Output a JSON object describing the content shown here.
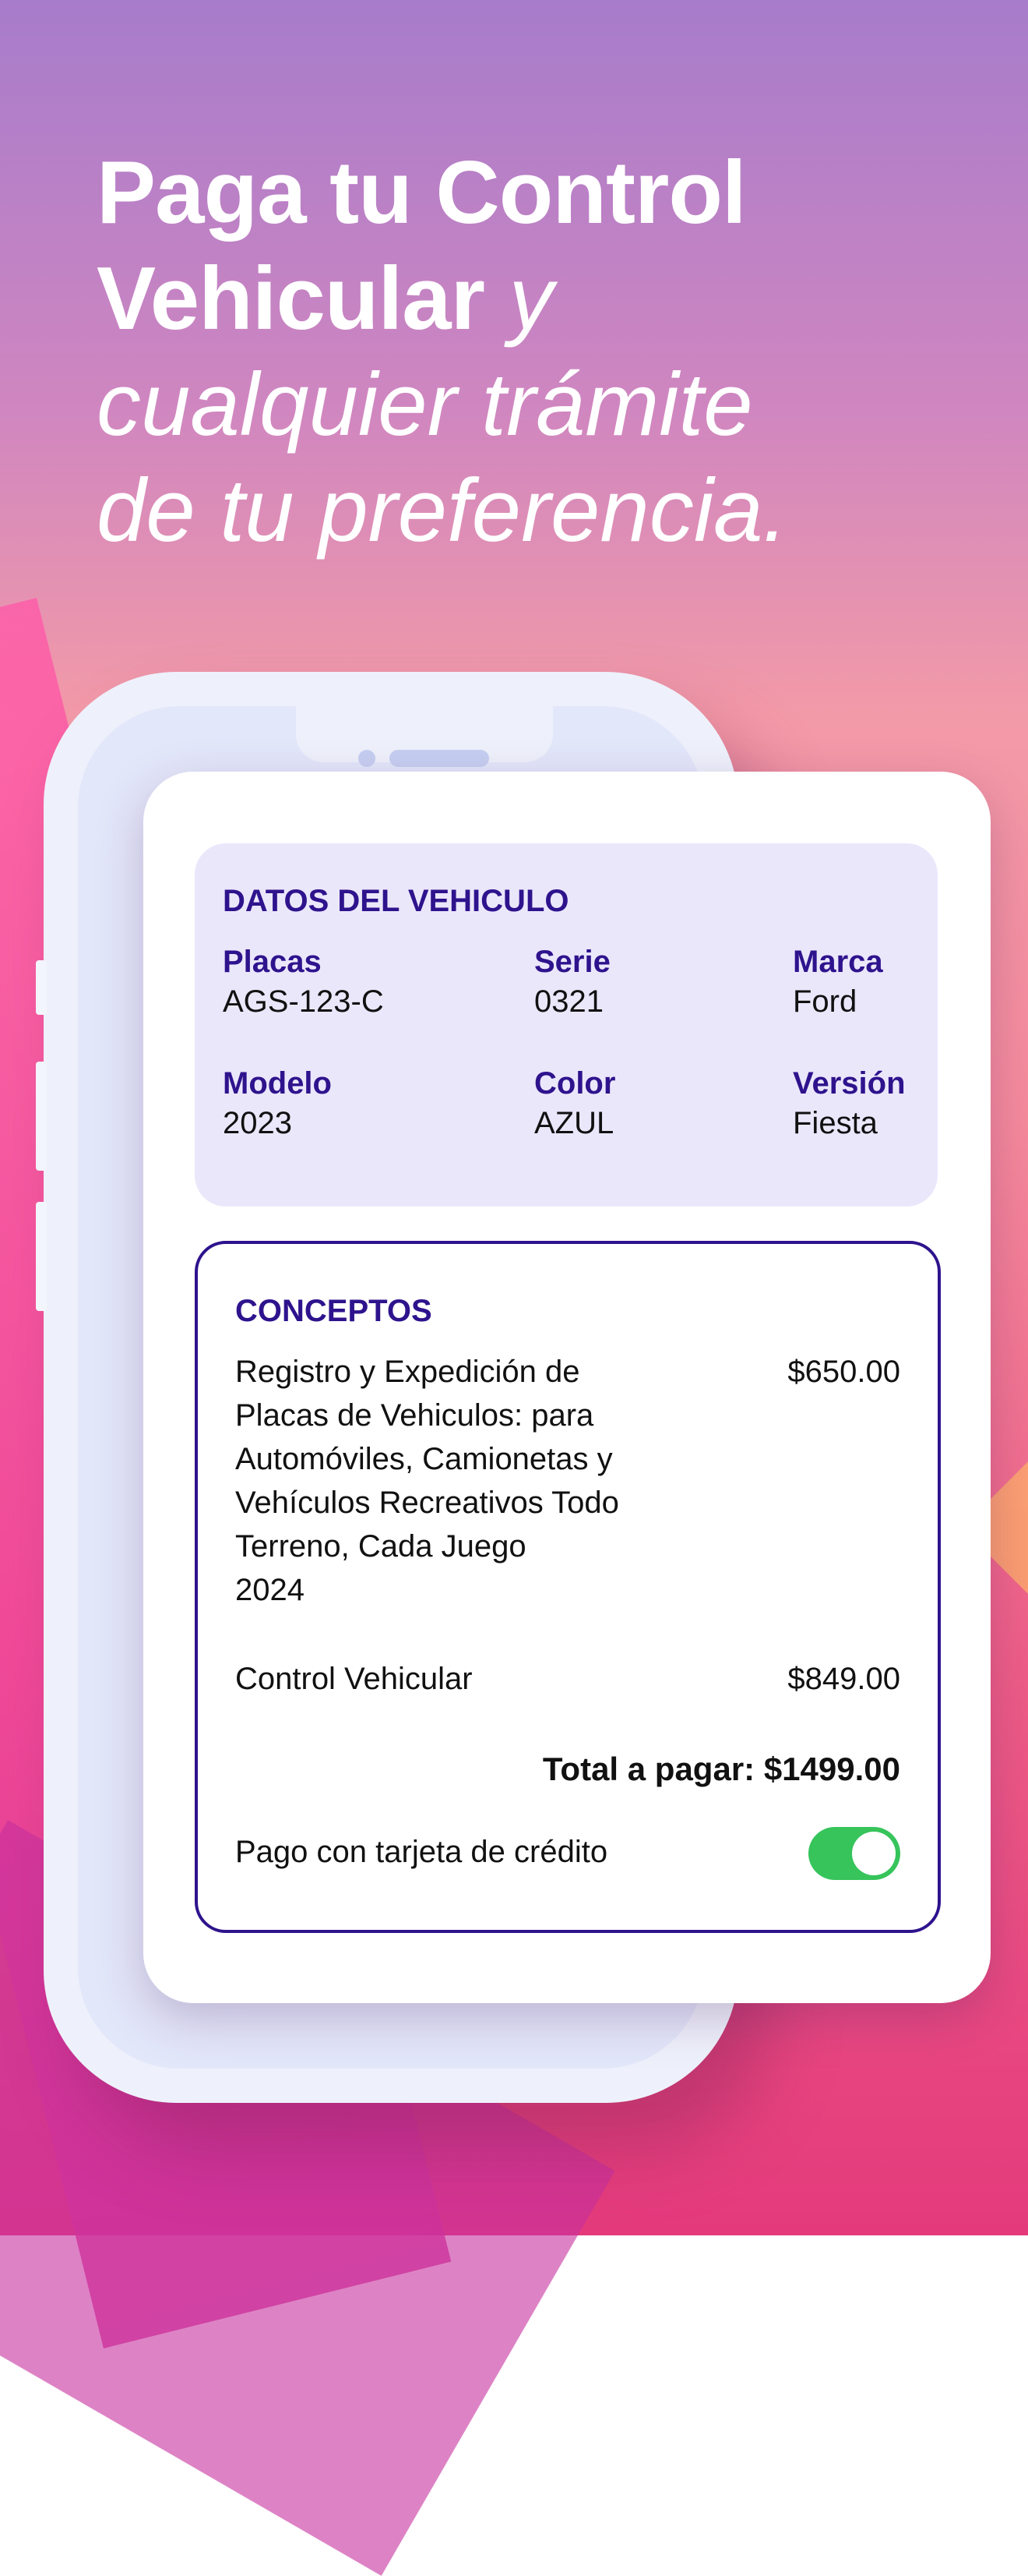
{
  "headline": {
    "line1": "Paga tu Control",
    "line2_bold": "Vehicular",
    "line2_rest": " y",
    "line3": "cualquier trámite",
    "line4": "de tu preferencia."
  },
  "vehicle": {
    "title": "DATOS DEL VEHICULO",
    "fields": [
      {
        "label": "Placas",
        "value": "AGS-123-C"
      },
      {
        "label": "Serie",
        "value": "0321"
      },
      {
        "label": "Marca",
        "value": "Ford"
      },
      {
        "label": "Modelo",
        "value": "2023"
      },
      {
        "label": "Color",
        "value": "AZUL"
      },
      {
        "label": "Versión",
        "value": "Fiesta"
      }
    ]
  },
  "concepts": {
    "title": "CONCEPTOS",
    "items": [
      {
        "lines": [
          "Registro y Expedición de",
          "Placas de Vehiculos: para",
          "Automóviles, Camionetas y",
          "Vehículos Recreativos Todo",
          "Terreno, Cada Juego",
          "2024"
        ],
        "amount": "$650.00"
      },
      {
        "lines": [
          "Control Vehicular"
        ],
        "amount": "$849.00"
      }
    ],
    "total": "Total a pagar: $1499.00",
    "payment_label": "Pago con tarjeta de crédito",
    "payment_toggle_on": true
  },
  "colors": {
    "accent": "#2e138d",
    "toggle_on": "#36c45b"
  }
}
